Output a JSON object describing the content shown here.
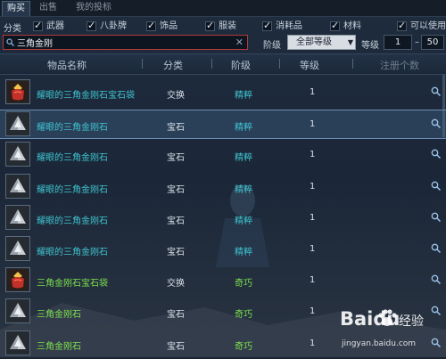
{
  "tabs": [
    {
      "label": "购买",
      "active": true
    },
    {
      "label": "出售",
      "active": false
    },
    {
      "label": "我的投标",
      "active": false
    }
  ],
  "filters": {
    "label": "分类",
    "options": [
      {
        "label": "武器",
        "checked": true
      },
      {
        "label": "八卦牌",
        "checked": true
      },
      {
        "label": "饰品",
        "checked": true
      },
      {
        "label": "服装",
        "checked": true
      },
      {
        "label": "消耗品",
        "checked": true
      },
      {
        "label": "材料",
        "checked": true
      }
    ],
    "usable_label": "可以使用",
    "usable_checked": false
  },
  "search": {
    "value": "三角金刚"
  },
  "grade_filter": {
    "label": "阶级",
    "selected": "全部等级"
  },
  "level_filter": {
    "label": "等级",
    "min": "1",
    "max": "50",
    "separator": "–"
  },
  "columns": {
    "name": "物品名称",
    "category": "分类",
    "grade": "阶级",
    "level": "等级",
    "reg_count": "注册个数"
  },
  "items": [
    {
      "name": "耀眼的三角金刚石宝石袋",
      "category": "交换",
      "grade": "精粹",
      "level": "1",
      "icon": "gem-pouch-icon",
      "color": "#3fc3cf",
      "selected": false
    },
    {
      "name": "耀眼的三角金刚石",
      "category": "宝石",
      "grade": "精粹",
      "level": "1",
      "icon": "diamond-gem-icon",
      "color": "#3fc3cf",
      "selected": true
    },
    {
      "name": "耀眼的三角金刚石",
      "category": "宝石",
      "grade": "精粹",
      "level": "1",
      "icon": "diamond-gem-icon",
      "color": "#3fc3cf",
      "selected": false
    },
    {
      "name": "耀眼的三角金刚石",
      "category": "宝石",
      "grade": "精粹",
      "level": "1",
      "icon": "diamond-gem-icon",
      "color": "#3fc3cf",
      "selected": false
    },
    {
      "name": "耀眼的三角金刚石",
      "category": "宝石",
      "grade": "精粹",
      "level": "1",
      "icon": "diamond-gem-icon",
      "color": "#3fc3cf",
      "selected": false
    },
    {
      "name": "耀眼的三角金刚石",
      "category": "宝石",
      "grade": "精粹",
      "level": "1",
      "icon": "diamond-gem-icon",
      "color": "#3fc3cf",
      "selected": false
    },
    {
      "name": "三角金刚石宝石袋",
      "category": "交换",
      "grade": "奇巧",
      "level": "1",
      "icon": "gem-pouch-icon",
      "color": "#7be04f",
      "selected": false
    },
    {
      "name": "三角金刚石",
      "category": "宝石",
      "grade": "奇巧",
      "level": "1",
      "icon": "diamond-gem-icon",
      "color": "#7be04f",
      "selected": false
    },
    {
      "name": "三角金刚石",
      "category": "宝石",
      "grade": "奇巧",
      "level": "1",
      "icon": "diamond-gem-icon",
      "color": "#7be04f",
      "selected": false
    }
  ],
  "watermark": {
    "brand": "Baidu",
    "suffix": "经验",
    "url": "jingyan.baidu.com"
  }
}
